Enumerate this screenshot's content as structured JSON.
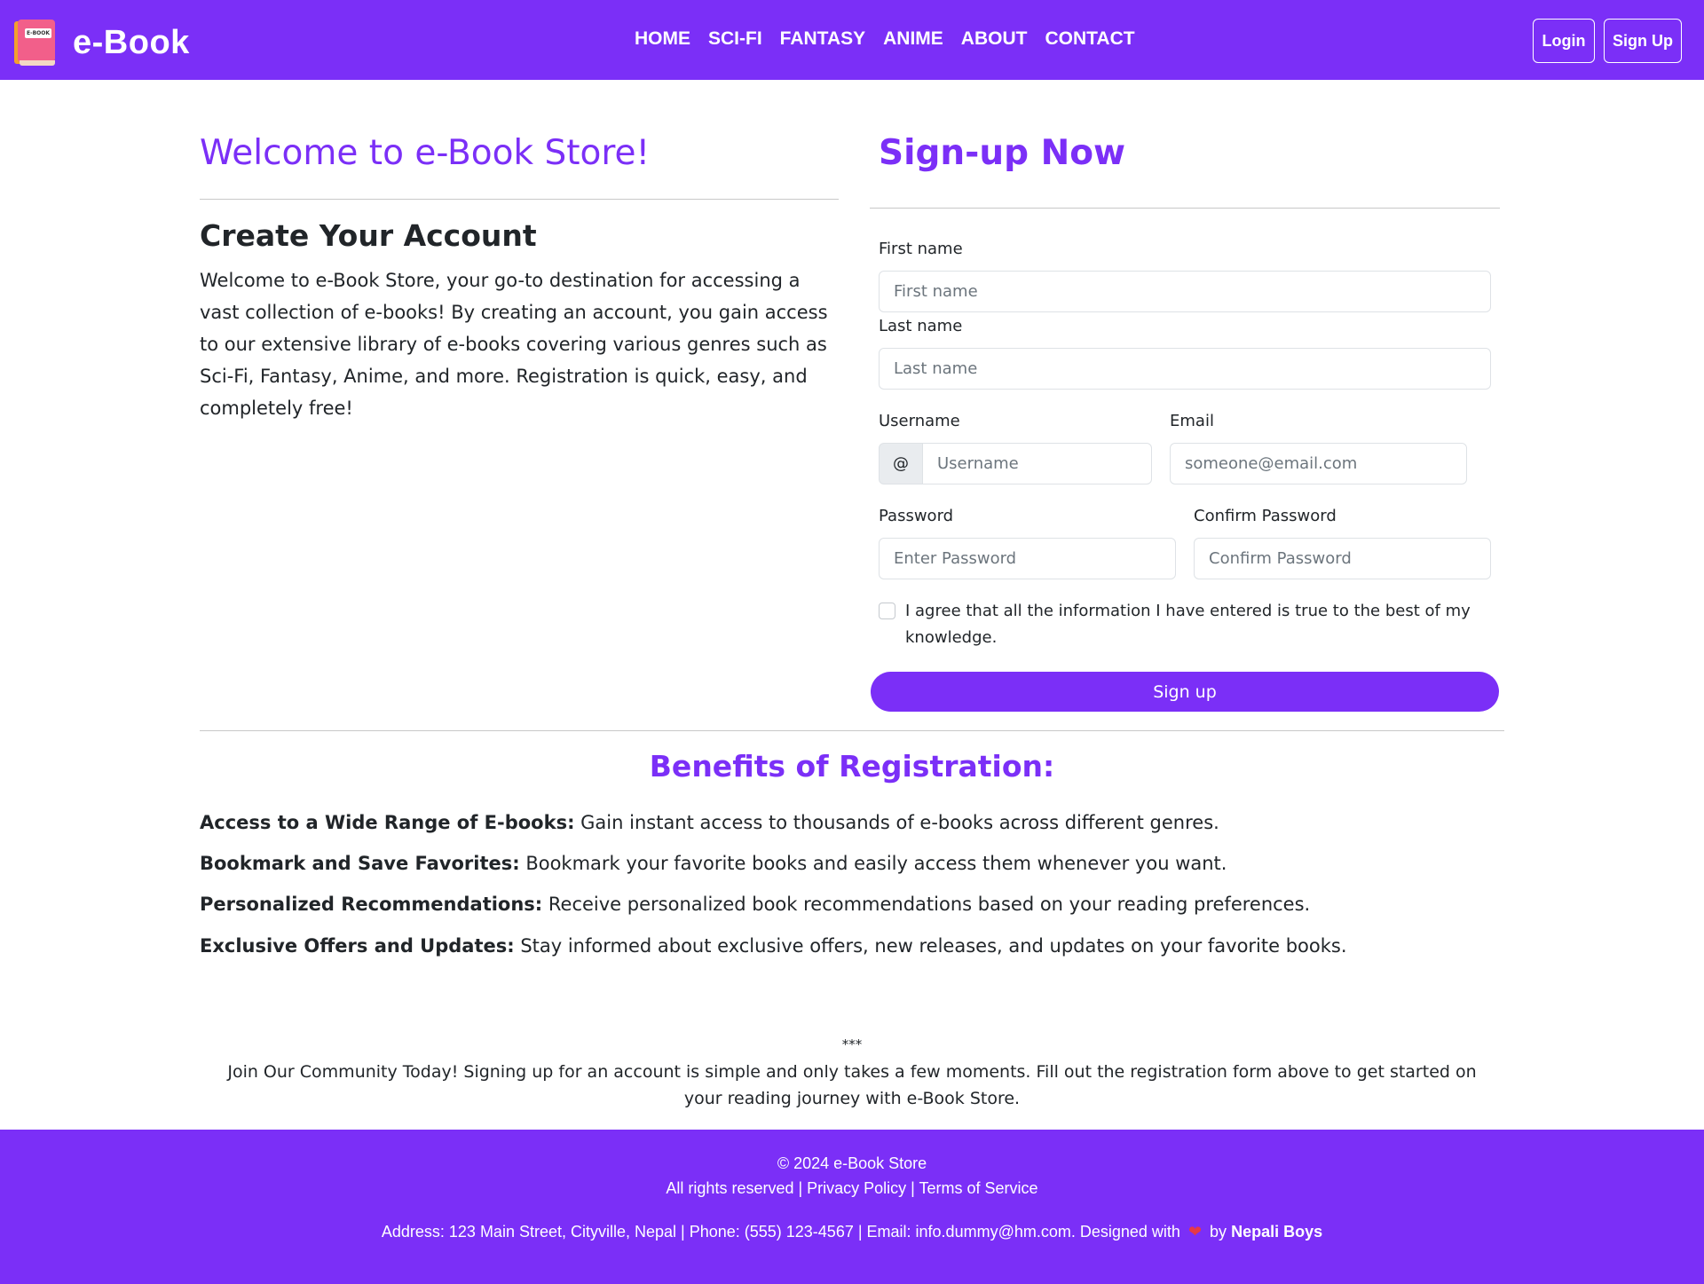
{
  "navbar": {
    "logo_tag": "E-BOOK",
    "brand": "e-Book",
    "links": [
      "HOME",
      "SCI-FI",
      "FANTASY",
      "ANIME",
      "ABOUT",
      "CONTACT"
    ],
    "login_label": "Login",
    "signup_label": "Sign Up"
  },
  "left": {
    "welcome_title": "Welcome to e-Book Store!",
    "create_title": "Create Your Account",
    "intro": "Welcome to e-Book Store, your go-to destination for accessing a vast collection of e-books! By creating an account, you gain access to our extensive library of e-books covering various genres such as Sci-Fi, Fantasy, Anime, and more. Registration is quick, easy, and completely free!"
  },
  "form": {
    "title": "Sign-up Now",
    "first_name_label": "First name",
    "first_name_placeholder": "First name",
    "last_name_label": "Last name",
    "last_name_placeholder": "Last name",
    "username_label": "Username",
    "username_prefix": "@",
    "username_placeholder": "Username",
    "email_label": "Email",
    "email_placeholder": "someone@email.com",
    "password_label": "Password",
    "password_placeholder": "Enter Password",
    "confirm_label": "Confirm Password",
    "confirm_placeholder": "Confirm Password",
    "agree_text": "I agree that all the information I have entered is true to the best of my knowledge.",
    "submit_label": "Sign up"
  },
  "benefits": {
    "title": "Benefits of Registration:",
    "items": [
      {
        "bold": "Access to a Wide Range of E-books:",
        "text": " Gain instant access to thousands of e-books across different genres."
      },
      {
        "bold": "Bookmark and Save Favorites:",
        "text": " Bookmark your favorite books and easily access them whenever you want."
      },
      {
        "bold": "Personalized Recommendations:",
        "text": " Receive personalized book recommendations based on your reading preferences."
      },
      {
        "bold": "Exclusive Offers and Updates:",
        "text": " Stay informed about exclusive offers, new releases, and updates on your favorite books."
      }
    ]
  },
  "community": {
    "stars": "***",
    "text": "Join Our Community Today! Signing up for an account is simple and only takes a few moments. Fill out the registration form above to get started on your reading journey with e-Book Store."
  },
  "footer": {
    "copyright": "© 2024 e-Book Store",
    "rights": "All rights reserved | Privacy Policy | Terms of Service",
    "address": "Address: 123 Main Street, Cityville, Nepal | Phone: (555) 123-4567 | Email: info.dummy@hm.com. Designed with",
    "heart_icon": "❤",
    "by": "by",
    "author": "Nepali Boys"
  },
  "colors": {
    "primary": "#7b2ff7"
  }
}
